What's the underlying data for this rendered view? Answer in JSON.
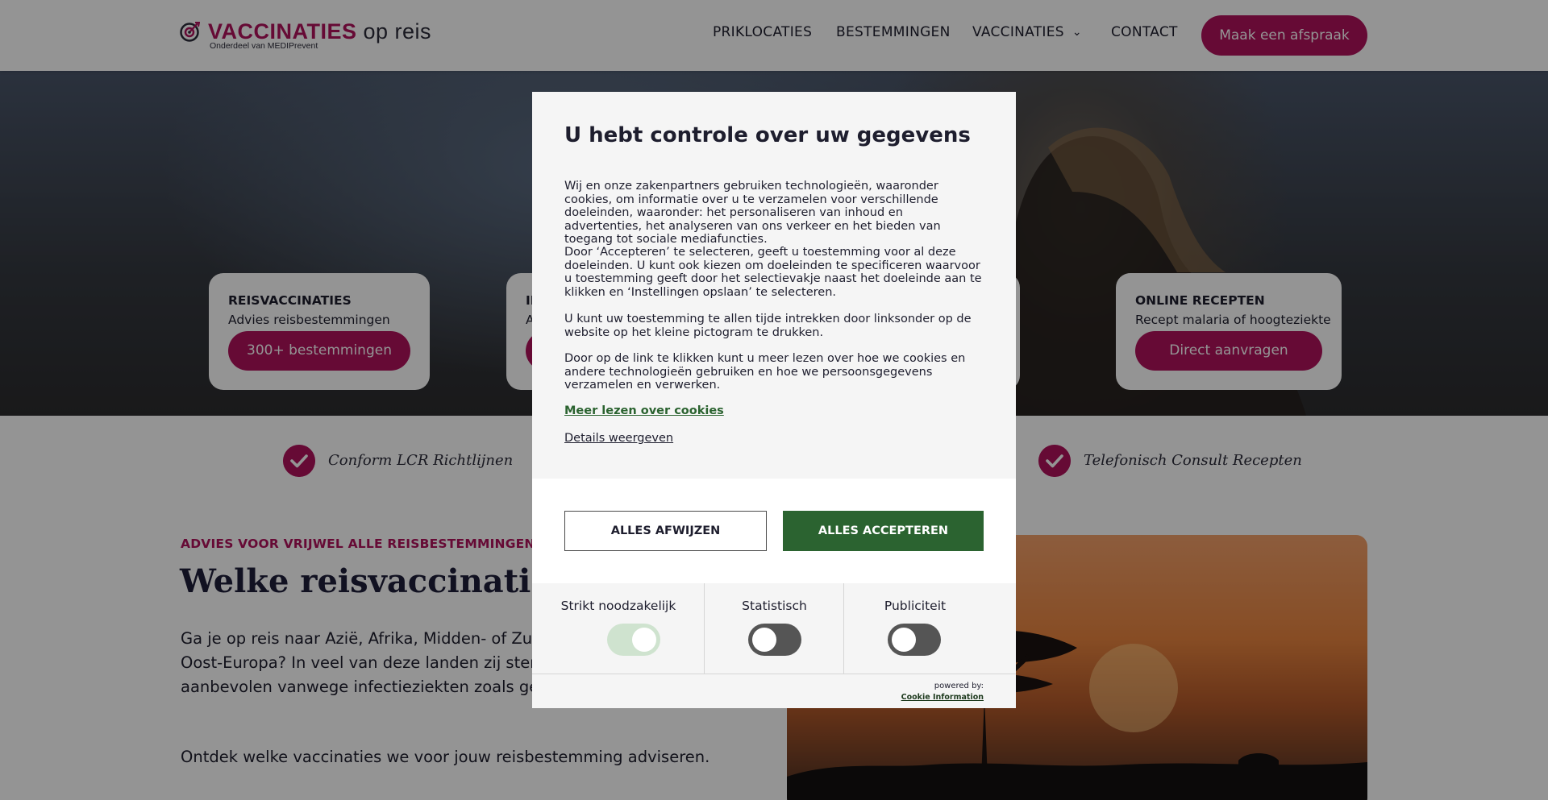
{
  "header": {
    "logo_main": "VACCINATIES",
    "logo_light": " op reis",
    "logo_sub": "Onderdeel van MEDIPrevent",
    "nav": [
      "PRIKLOCATIES",
      "BESTEMMINGEN",
      "VACCINATIES",
      "CONTACT"
    ],
    "cta": "Maak een afspraak"
  },
  "hero_cards": [
    {
      "title": "REISVACCINATIES",
      "subtitle": "Advies reisbestemmingen",
      "button": "300+ bestemmingen"
    },
    {
      "title": "IN",
      "subtitle": "A",
      "button": ""
    },
    {
      "title": "ONLINE RECEPTEN",
      "subtitle": "Recept malaria of hoogteziekte",
      "button": "Direct aanvragen"
    }
  ],
  "usps": [
    "Conform LCR Richtlijnen",
    "Telefonisch Consult Recepten"
  ],
  "content": {
    "eyebrow": "ADVIES VOOR VRIJWEL ALLE REISBESTEMMINGEN",
    "heading": "Welke reisvaccinaties he",
    "paragraph": "Ga je op reis naar Azië, Afrika, Midden- of Zuid-A Zee of Oost-Europa? In veel van deze landen zij sterk aanbevolen vanwege infectieziekten zoals gele koorts.",
    "paragraph2": "Ontdek welke vaccinaties we voor jouw reisbestemming adviseren."
  },
  "cookie_modal": {
    "title": "U hebt controle over uw gegevens",
    "p1": "Wij en onze zakenpartners gebruiken technologieën, waaronder cookies, om informatie over u te verzamelen voor verschillende doeleinden, waaronder: het personaliseren van inhoud en advertenties, het analyseren van ons verkeer en het bieden van toegang tot sociale mediafuncties.",
    "p2": "Door ‘Accepteren’ te selecteren, geeft u toestemming voor al deze doeleinden. U kunt ook kiezen om doeleinden te specificeren waarvoor u toestemming geeft door het selectievakje naast het doeleinde aan te klikken en ‘Instellingen opslaan’ te selecteren.",
    "p3": "U kunt uw toestemming te allen tijde intrekken door linksonder op de website op het kleine pictogram te drukken.",
    "p4": "Door op de link te klikken kunt u meer lezen over hoe we cookies en andere technologieën gebruiken en hoe we persoonsgegevens verzamelen en verwerken.",
    "link_more": "Meer lezen over cookies",
    "link_details": "Details weergeven",
    "btn_reject": "ALLES AFWIJZEN",
    "btn_accept": "ALLES ACCEPTEREN",
    "categories": [
      {
        "label": "Strikt noodzakelijk",
        "on": true
      },
      {
        "label": "Statistisch",
        "on": false
      },
      {
        "label": "Publiciteit",
        "on": false
      }
    ],
    "powered_by": "powered by:",
    "powered_name": "Cookie Information"
  },
  "colors": {
    "brand": "#b0125c",
    "accept": "#2b6330",
    "toggle_off": "#555555",
    "toggle_on": "#cfe3cf"
  },
  "icons": [
    "target-logo-icon",
    "chevron-down-icon",
    "checkmark-icon"
  ]
}
